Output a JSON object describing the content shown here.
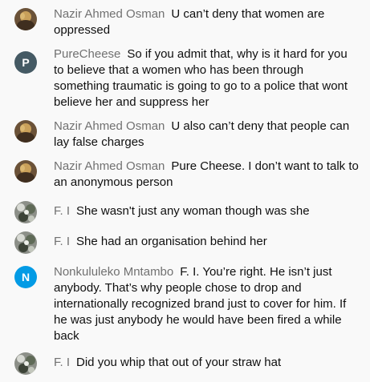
{
  "colors": {
    "background": "#f9f9f9",
    "author_text": "#717171",
    "message_text": "#0f0f0f",
    "avatar_purecheese": "#455a64",
    "avatar_nonkululeko": "#039be5"
  },
  "messages": [
    {
      "author": "Nazir Ahmed Osman",
      "text": "U can’t deny that women are oppressed",
      "avatar": "photo-avatar-nazir"
    },
    {
      "author": "PureCheese",
      "text": "So if you admit that, why is it hard for you to believe that a women who has been through something traumatic is going to go to a police that wont believe her and suppress her",
      "avatar": "letter-avatar",
      "avatar_letter": "P"
    },
    {
      "author": "Nazir Ahmed Osman",
      "text": "U also can’t deny that people can lay false charges",
      "avatar": "photo-avatar-nazir"
    },
    {
      "author": "Nazir Ahmed Osman",
      "text": "Pure Cheese. I don’t want to talk to an anonymous person",
      "avatar": "photo-avatar-nazir"
    },
    {
      "author": "F. I",
      "text": "She wasn't just any woman though was she",
      "avatar": "photo-avatar-fi"
    },
    {
      "author": "F. I",
      "text": "She had an organisation behind her",
      "avatar": "photo-avatar-fi"
    },
    {
      "author": "Nonkululeko Mntambo",
      "text": "F. I. You’re right. He isn’t just anybody. That’s why people chose to drop and internationally recognized brand just to cover for him. If he was just anybody he would have been fired a while back",
      "avatar": "letter-avatar",
      "avatar_letter": "N"
    },
    {
      "author": "F. I",
      "text": "Did you whip that out of your straw hat",
      "avatar": "photo-avatar-fi"
    }
  ]
}
